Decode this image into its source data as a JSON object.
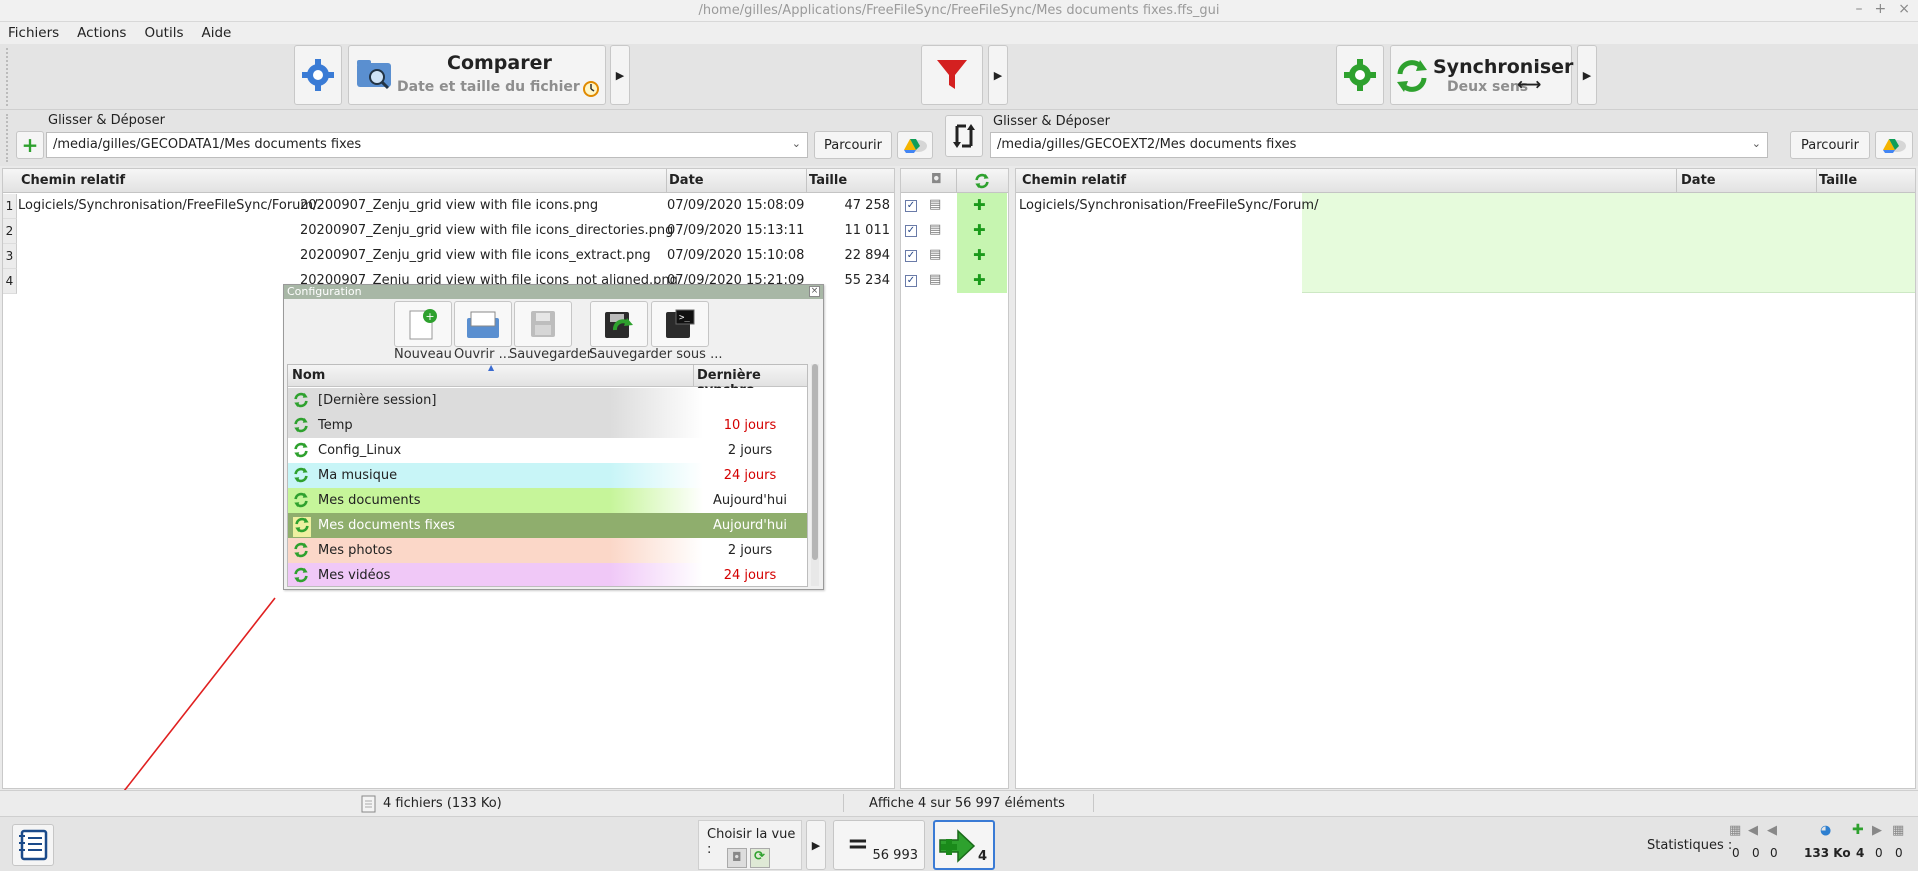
{
  "window": {
    "title": "/home/gilles/Applications/FreeFileSync/FreeFileSync/Mes documents fixes.ffs_gui",
    "controls": [
      "–",
      "+",
      "×"
    ]
  },
  "menu": [
    "Fichiers",
    "Actions",
    "Outils",
    "Aide"
  ],
  "toolbar": {
    "compare_label": "Comparer",
    "compare_sub": "Date et taille du fichier",
    "sync_label": "Synchroniser",
    "sync_sub": "Deux sens"
  },
  "left_folder": {
    "drop_label": "Glisser & Déposer",
    "path": "/media/gilles/GECODATA1/Mes documents fixes",
    "browse": "Parcourir"
  },
  "right_folder": {
    "drop_label": "Glisser & Déposer",
    "path": "/media/gilles/GECOEXT2/Mes documents fixes",
    "browse": "Parcourir"
  },
  "left_grid": {
    "headers": {
      "path": "Chemin relatif",
      "date": "Date",
      "size": "Taille"
    },
    "rows": [
      {
        "num": "1",
        "prefix": "Logiciels/Synchronisation/FreeFileSync/Forum/",
        "name": "20200907_Zenju_grid view with file icons.png",
        "date": "07/09/2020  15:08:09",
        "size": "47 258"
      },
      {
        "num": "2",
        "prefix": "",
        "name": "20200907_Zenju_grid view with file icons_directories.png",
        "date": "07/09/2020  15:13:11",
        "size": "11 011"
      },
      {
        "num": "3",
        "prefix": "",
        "name": "20200907_Zenju_grid view with file icons_extract.png",
        "date": "07/09/2020  15:10:08",
        "size": "22 894"
      },
      {
        "num": "4",
        "prefix": "",
        "name": "20200907_Zenju_grid view with file icons_not aligned.png",
        "date": "07/09/2020  15:21:09",
        "size": "55 234"
      }
    ]
  },
  "right_grid": {
    "headers": {
      "path": "Chemin relatif",
      "date": "Date",
      "size": "Taille"
    },
    "rows": [
      {
        "prefix": "Logiciels/Synchronisation/FreeFileSync/Forum/"
      }
    ]
  },
  "config": {
    "title": "Configuration",
    "buttons": [
      "Nouveau",
      "Ouvrir ...",
      "Sauvegarder",
      "Sauvegarder sous ..."
    ],
    "headers": {
      "name": "Nom",
      "last_sync": "Dernière synchro"
    },
    "rows": [
      {
        "name": "[Dernière session]",
        "last": "",
        "late": false,
        "color": "#dcdcdc"
      },
      {
        "name": "Temp",
        "last": "10 jours",
        "late": true,
        "color": "#dcdcdc"
      },
      {
        "name": "Config_Linux",
        "last": "2 jours",
        "late": false,
        "color": "#ffffff"
      },
      {
        "name": "Ma musique",
        "last": "24 jours",
        "late": true,
        "color": "#c8f5f7"
      },
      {
        "name": "Mes documents",
        "last": "Aujourd'hui",
        "late": false,
        "color": "#c6f59a"
      },
      {
        "name": "Mes documents fixes",
        "last": "Aujourd'hui",
        "late": false,
        "color": "#8fae6d",
        "selected": true
      },
      {
        "name": "Mes photos",
        "last": "2 jours",
        "late": false,
        "color": "#fbd7c8"
      },
      {
        "name": "Mes vidéos",
        "last": "24 jours",
        "late": true,
        "color": "#f0c8f7"
      }
    ]
  },
  "status": {
    "left": "4 fichiers (133 Ko)",
    "center": "Affiche 4 sur 56 997 éléments"
  },
  "bottom": {
    "choose_view": "Choisir la vue :",
    "equal_count": "56 993",
    "create_right_count": "4",
    "stats_label": "Statistiques :",
    "stats": [
      "0",
      "0",
      "0",
      "133 Ko",
      "4",
      "0",
      "0"
    ]
  },
  "colors": {
    "accent_green": "#2ea12e",
    "late_red": "#d40000",
    "selected_row": "#8fae6d",
    "right_empty_green": "#e6fbdc",
    "arrow_red": "#e02020"
  }
}
